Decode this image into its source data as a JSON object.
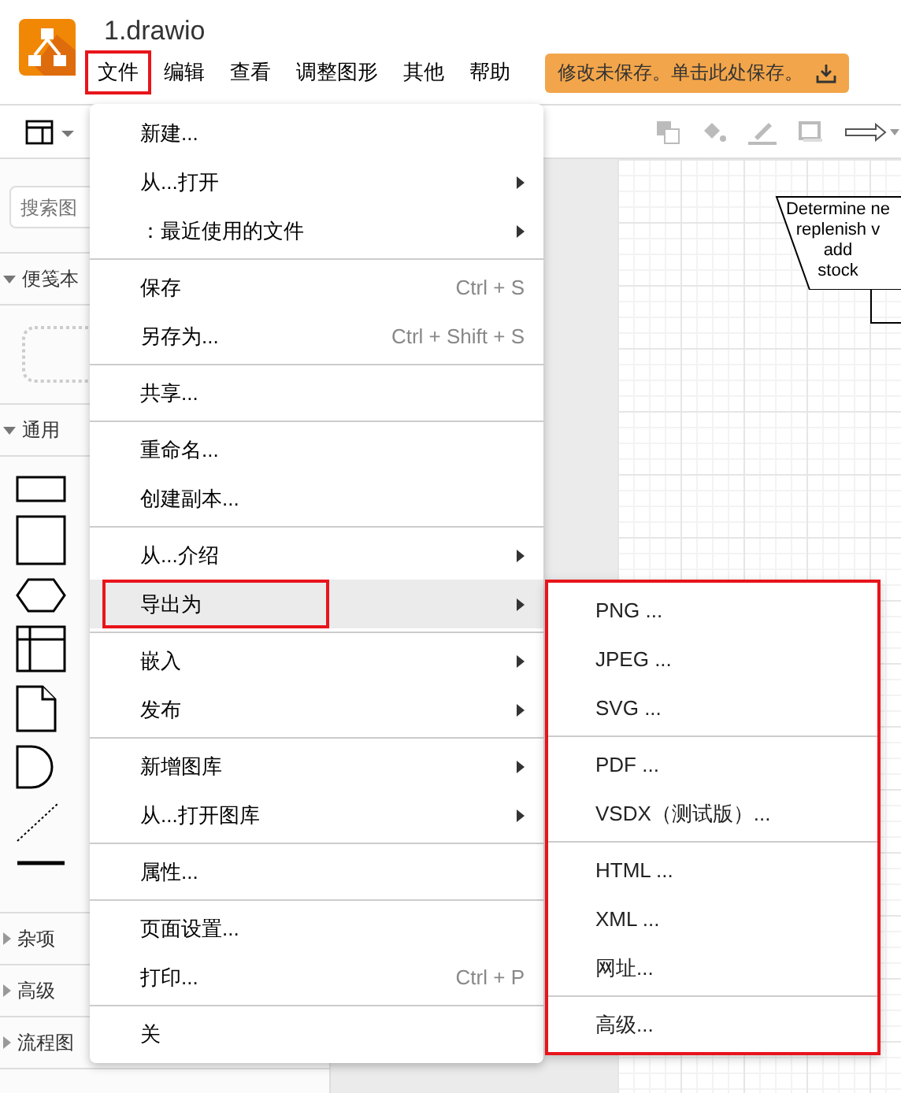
{
  "app": {
    "title": "1.drawio",
    "menubar": [
      {
        "label": "文件",
        "annotated": true
      },
      {
        "label": "编辑",
        "annotated": false
      },
      {
        "label": "查看",
        "annotated": false
      },
      {
        "label": "调整图形",
        "annotated": false
      },
      {
        "label": "其他",
        "annotated": false
      },
      {
        "label": "帮助",
        "annotated": false
      }
    ],
    "save_notice": "修改未保存。单击此处保存。"
  },
  "sidebar": {
    "search": {
      "placeholder": "搜索图"
    },
    "sections": [
      {
        "label": "便笺本",
        "kind": "scratchpad",
        "expanded": true
      },
      {
        "label": "通用",
        "kind": "shapes",
        "expanded": true
      },
      {
        "label": "杂项",
        "kind": "shapes",
        "expanded": false
      },
      {
        "label": "高级",
        "kind": "shapes",
        "expanded": false
      },
      {
        "label": "流程图",
        "kind": "shapes",
        "expanded": false
      }
    ]
  },
  "canvas": {
    "shape_lines": [
      "Determine ne",
      "replenish v",
      "add",
      "stock"
    ]
  },
  "file_menu": {
    "items": [
      {
        "kind": "item",
        "label": "新建...",
        "submenu": false,
        "selected": false,
        "annotated": false
      },
      {
        "kind": "item",
        "label": "从...打开",
        "submenu": true,
        "selected": false,
        "annotated": false
      },
      {
        "kind": "item",
        "label": "：最近使用的文件",
        "submenu": true,
        "selected": false,
        "annotated": false
      },
      {
        "kind": "separator"
      },
      {
        "kind": "item",
        "label": "保存",
        "shortcut": "Ctrl + S",
        "submenu": false,
        "selected": false,
        "annotated": false
      },
      {
        "kind": "item",
        "label": "另存为...",
        "shortcut": "Ctrl + Shift + S",
        "submenu": false,
        "selected": false,
        "annotated": false
      },
      {
        "kind": "separator"
      },
      {
        "kind": "item",
        "label": "共享...",
        "submenu": false,
        "selected": false,
        "annotated": false
      },
      {
        "kind": "separator"
      },
      {
        "kind": "item",
        "label": "重命名...",
        "submenu": false,
        "selected": false,
        "annotated": false
      },
      {
        "kind": "item",
        "label": "创建副本...",
        "submenu": false,
        "selected": false,
        "annotated": false
      },
      {
        "kind": "separator"
      },
      {
        "kind": "item",
        "label": "从...介绍",
        "submenu": true,
        "selected": false,
        "annotated": false
      },
      {
        "kind": "item",
        "label": "导出为",
        "submenu": true,
        "selected": true,
        "annotated": true
      },
      {
        "kind": "separator"
      },
      {
        "kind": "item",
        "label": "嵌入",
        "submenu": true,
        "selected": false,
        "annotated": false
      },
      {
        "kind": "item",
        "label": "发布",
        "submenu": true,
        "selected": false,
        "annotated": false
      },
      {
        "kind": "separator"
      },
      {
        "kind": "item",
        "label": "新增图库",
        "submenu": true,
        "selected": false,
        "annotated": false
      },
      {
        "kind": "item",
        "label": "从...打开图库",
        "submenu": true,
        "selected": false,
        "annotated": false
      },
      {
        "kind": "separator"
      },
      {
        "kind": "item",
        "label": "属性...",
        "submenu": false,
        "selected": false,
        "annotated": false
      },
      {
        "kind": "separator"
      },
      {
        "kind": "item",
        "label": "页面设置...",
        "submenu": false,
        "selected": false,
        "annotated": false
      },
      {
        "kind": "item",
        "label": "打印...",
        "shortcut": "Ctrl + P",
        "submenu": false,
        "selected": false,
        "annotated": false
      },
      {
        "kind": "separator"
      },
      {
        "kind": "item",
        "label": "关",
        "submenu": false,
        "selected": false,
        "annotated": false
      }
    ]
  },
  "export_submenu": {
    "annotated": true,
    "items": [
      {
        "kind": "item",
        "label": "PNG ..."
      },
      {
        "kind": "item",
        "label": "JPEG ..."
      },
      {
        "kind": "item",
        "label": "SVG ..."
      },
      {
        "kind": "separator"
      },
      {
        "kind": "item",
        "label": "PDF ..."
      },
      {
        "kind": "item",
        "label": "VSDX（测试版）..."
      },
      {
        "kind": "separator"
      },
      {
        "kind": "item",
        "label": "HTML ..."
      },
      {
        "kind": "item",
        "label": "XML ..."
      },
      {
        "kind": "item",
        "label": "网址..."
      },
      {
        "kind": "separator"
      },
      {
        "kind": "item",
        "label": "高级..."
      }
    ]
  }
}
